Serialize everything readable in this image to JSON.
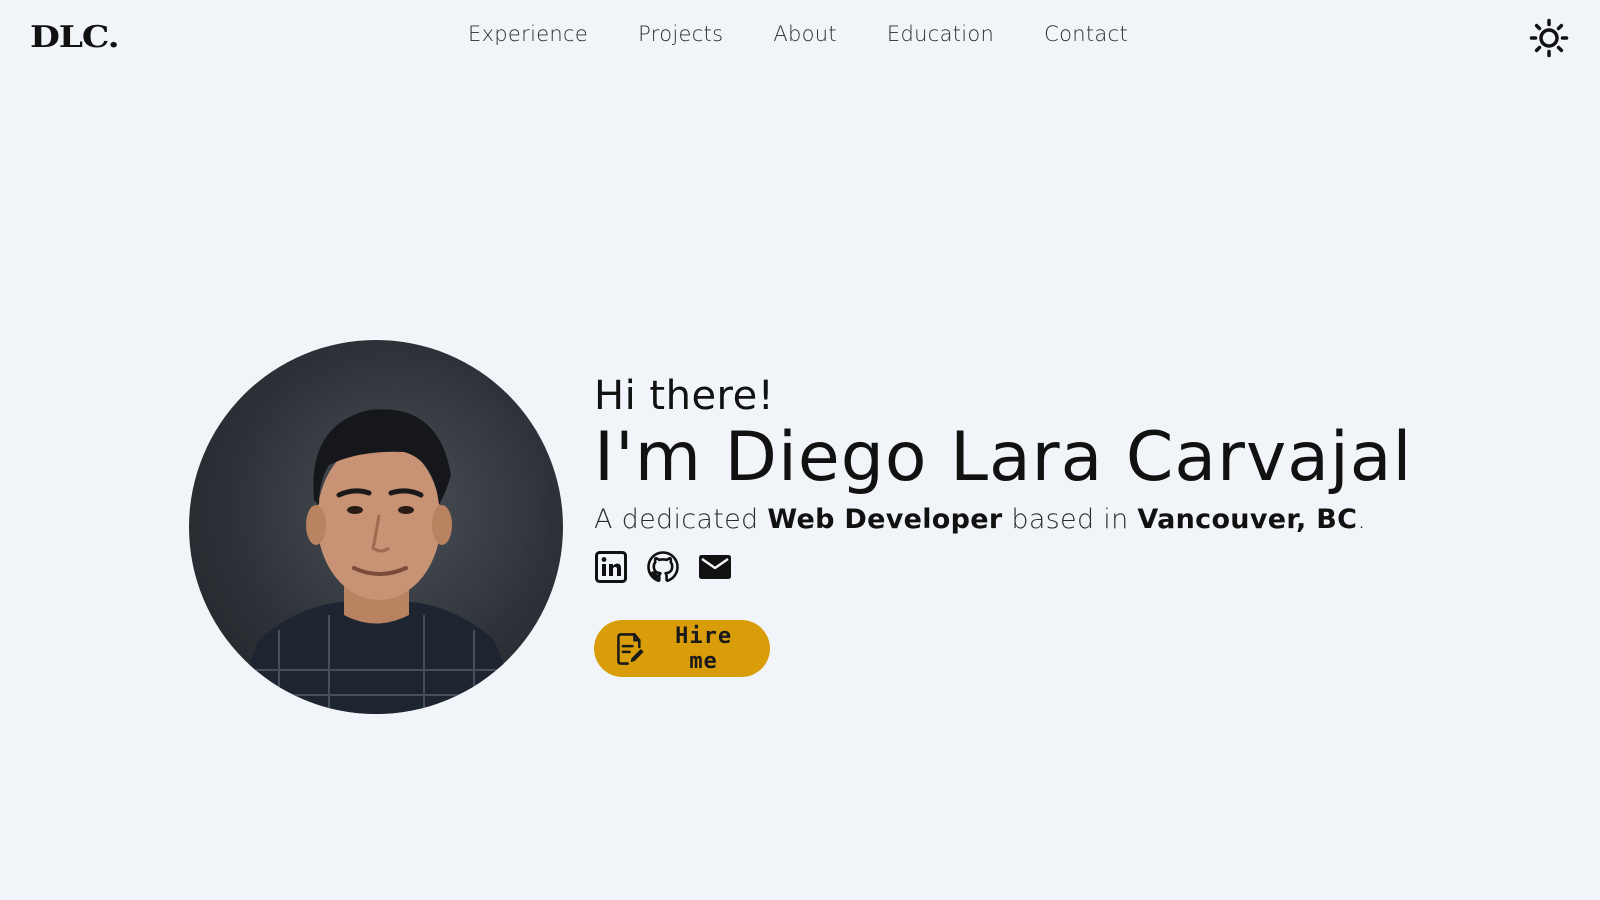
{
  "header": {
    "logo_text": "DLC.",
    "nav": [
      {
        "label": "Experience"
      },
      {
        "label": "Projects"
      },
      {
        "label": "About"
      },
      {
        "label": "Education"
      },
      {
        "label": "Contact"
      }
    ],
    "theme_toggle_icon": "sun-icon"
  },
  "hero": {
    "greeting": "Hi there!",
    "name": "I'm Diego Lara Carvajal",
    "tagline": {
      "prefix": "A dedicated ",
      "role": "Web Developer",
      "middle": " based in ",
      "location": "Vancouver, BC",
      "suffix": "."
    },
    "socials": [
      {
        "icon": "linkedin-icon"
      },
      {
        "icon": "github-icon"
      },
      {
        "icon": "email-icon"
      }
    ],
    "cta": {
      "label": "Hire me",
      "icon": "document-edit-icon"
    },
    "avatar_icon": "profile-photo"
  },
  "colors": {
    "background": "#f1f5f9",
    "accent": "#d99d0a",
    "text": "#111111"
  }
}
